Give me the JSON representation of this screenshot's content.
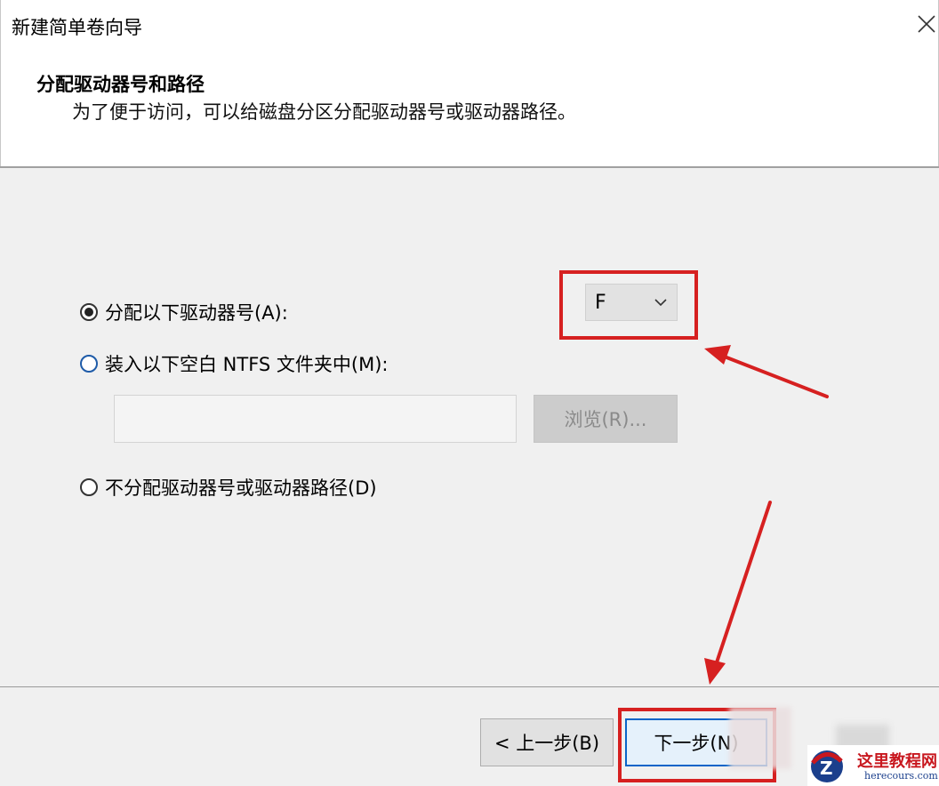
{
  "window": {
    "title": "新建简单卷向导",
    "close_icon": "close-icon"
  },
  "header": {
    "heading": "分配驱动器号和路径",
    "subheading": "为了便于访问，可以给磁盘分区分配驱动器号或驱动器路径。"
  },
  "options": {
    "assign_letter": {
      "label": "分配以下驱动器号(A):",
      "selected": true
    },
    "mount_folder": {
      "label": "装入以下空白 NTFS 文件夹中(M):",
      "selected": false
    },
    "no_assign": {
      "label": "不分配驱动器号或驱动器路径(D)",
      "selected": false
    }
  },
  "drive_letter": {
    "value": "F",
    "icon": "chevron-down-icon"
  },
  "folder_path": {
    "value": ""
  },
  "browse_button": {
    "label": "浏览(R)...",
    "enabled": false
  },
  "footer": {
    "back_label": "< 上一步(B)",
    "next_label": "下一步(N)"
  },
  "annotation": {
    "color": "#d62020"
  },
  "watermark": {
    "name": "这里教程网",
    "url": "herecours.com"
  }
}
